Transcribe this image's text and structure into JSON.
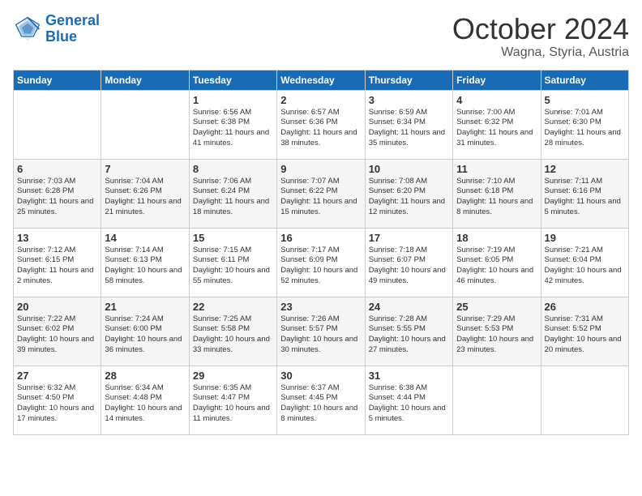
{
  "header": {
    "logo_line1": "General",
    "logo_line2": "Blue",
    "month": "October 2024",
    "location": "Wagna, Styria, Austria"
  },
  "weekdays": [
    "Sunday",
    "Monday",
    "Tuesday",
    "Wednesday",
    "Thursday",
    "Friday",
    "Saturday"
  ],
  "weeks": [
    [
      {
        "day": null,
        "sunrise": null,
        "sunset": null,
        "daylight": null
      },
      {
        "day": null,
        "sunrise": null,
        "sunset": null,
        "daylight": null
      },
      {
        "day": "1",
        "sunrise": "Sunrise: 6:56 AM",
        "sunset": "Sunset: 6:38 PM",
        "daylight": "Daylight: 11 hours and 41 minutes."
      },
      {
        "day": "2",
        "sunrise": "Sunrise: 6:57 AM",
        "sunset": "Sunset: 6:36 PM",
        "daylight": "Daylight: 11 hours and 38 minutes."
      },
      {
        "day": "3",
        "sunrise": "Sunrise: 6:59 AM",
        "sunset": "Sunset: 6:34 PM",
        "daylight": "Daylight: 11 hours and 35 minutes."
      },
      {
        "day": "4",
        "sunrise": "Sunrise: 7:00 AM",
        "sunset": "Sunset: 6:32 PM",
        "daylight": "Daylight: 11 hours and 31 minutes."
      },
      {
        "day": "5",
        "sunrise": "Sunrise: 7:01 AM",
        "sunset": "Sunset: 6:30 PM",
        "daylight": "Daylight: 11 hours and 28 minutes."
      }
    ],
    [
      {
        "day": "6",
        "sunrise": "Sunrise: 7:03 AM",
        "sunset": "Sunset: 6:28 PM",
        "daylight": "Daylight: 11 hours and 25 minutes."
      },
      {
        "day": "7",
        "sunrise": "Sunrise: 7:04 AM",
        "sunset": "Sunset: 6:26 PM",
        "daylight": "Daylight: 11 hours and 21 minutes."
      },
      {
        "day": "8",
        "sunrise": "Sunrise: 7:06 AM",
        "sunset": "Sunset: 6:24 PM",
        "daylight": "Daylight: 11 hours and 18 minutes."
      },
      {
        "day": "9",
        "sunrise": "Sunrise: 7:07 AM",
        "sunset": "Sunset: 6:22 PM",
        "daylight": "Daylight: 11 hours and 15 minutes."
      },
      {
        "day": "10",
        "sunrise": "Sunrise: 7:08 AM",
        "sunset": "Sunset: 6:20 PM",
        "daylight": "Daylight: 11 hours and 12 minutes."
      },
      {
        "day": "11",
        "sunrise": "Sunrise: 7:10 AM",
        "sunset": "Sunset: 6:18 PM",
        "daylight": "Daylight: 11 hours and 8 minutes."
      },
      {
        "day": "12",
        "sunrise": "Sunrise: 7:11 AM",
        "sunset": "Sunset: 6:16 PM",
        "daylight": "Daylight: 11 hours and 5 minutes."
      }
    ],
    [
      {
        "day": "13",
        "sunrise": "Sunrise: 7:12 AM",
        "sunset": "Sunset: 6:15 PM",
        "daylight": "Daylight: 11 hours and 2 minutes."
      },
      {
        "day": "14",
        "sunrise": "Sunrise: 7:14 AM",
        "sunset": "Sunset: 6:13 PM",
        "daylight": "Daylight: 10 hours and 58 minutes."
      },
      {
        "day": "15",
        "sunrise": "Sunrise: 7:15 AM",
        "sunset": "Sunset: 6:11 PM",
        "daylight": "Daylight: 10 hours and 55 minutes."
      },
      {
        "day": "16",
        "sunrise": "Sunrise: 7:17 AM",
        "sunset": "Sunset: 6:09 PM",
        "daylight": "Daylight: 10 hours and 52 minutes."
      },
      {
        "day": "17",
        "sunrise": "Sunrise: 7:18 AM",
        "sunset": "Sunset: 6:07 PM",
        "daylight": "Daylight: 10 hours and 49 minutes."
      },
      {
        "day": "18",
        "sunrise": "Sunrise: 7:19 AM",
        "sunset": "Sunset: 6:05 PM",
        "daylight": "Daylight: 10 hours and 46 minutes."
      },
      {
        "day": "19",
        "sunrise": "Sunrise: 7:21 AM",
        "sunset": "Sunset: 6:04 PM",
        "daylight": "Daylight: 10 hours and 42 minutes."
      }
    ],
    [
      {
        "day": "20",
        "sunrise": "Sunrise: 7:22 AM",
        "sunset": "Sunset: 6:02 PM",
        "daylight": "Daylight: 10 hours and 39 minutes."
      },
      {
        "day": "21",
        "sunrise": "Sunrise: 7:24 AM",
        "sunset": "Sunset: 6:00 PM",
        "daylight": "Daylight: 10 hours and 36 minutes."
      },
      {
        "day": "22",
        "sunrise": "Sunrise: 7:25 AM",
        "sunset": "Sunset: 5:58 PM",
        "daylight": "Daylight: 10 hours and 33 minutes."
      },
      {
        "day": "23",
        "sunrise": "Sunrise: 7:26 AM",
        "sunset": "Sunset: 5:57 PM",
        "daylight": "Daylight: 10 hours and 30 minutes."
      },
      {
        "day": "24",
        "sunrise": "Sunrise: 7:28 AM",
        "sunset": "Sunset: 5:55 PM",
        "daylight": "Daylight: 10 hours and 27 minutes."
      },
      {
        "day": "25",
        "sunrise": "Sunrise: 7:29 AM",
        "sunset": "Sunset: 5:53 PM",
        "daylight": "Daylight: 10 hours and 23 minutes."
      },
      {
        "day": "26",
        "sunrise": "Sunrise: 7:31 AM",
        "sunset": "Sunset: 5:52 PM",
        "daylight": "Daylight: 10 hours and 20 minutes."
      }
    ],
    [
      {
        "day": "27",
        "sunrise": "Sunrise: 6:32 AM",
        "sunset": "Sunset: 4:50 PM",
        "daylight": "Daylight: 10 hours and 17 minutes."
      },
      {
        "day": "28",
        "sunrise": "Sunrise: 6:34 AM",
        "sunset": "Sunset: 4:48 PM",
        "daylight": "Daylight: 10 hours and 14 minutes."
      },
      {
        "day": "29",
        "sunrise": "Sunrise: 6:35 AM",
        "sunset": "Sunset: 4:47 PM",
        "daylight": "Daylight: 10 hours and 11 minutes."
      },
      {
        "day": "30",
        "sunrise": "Sunrise: 6:37 AM",
        "sunset": "Sunset: 4:45 PM",
        "daylight": "Daylight: 10 hours and 8 minutes."
      },
      {
        "day": "31",
        "sunrise": "Sunrise: 6:38 AM",
        "sunset": "Sunset: 4:44 PM",
        "daylight": "Daylight: 10 hours and 5 minutes."
      },
      {
        "day": null,
        "sunrise": null,
        "sunset": null,
        "daylight": null
      },
      {
        "day": null,
        "sunrise": null,
        "sunset": null,
        "daylight": null
      }
    ]
  ]
}
